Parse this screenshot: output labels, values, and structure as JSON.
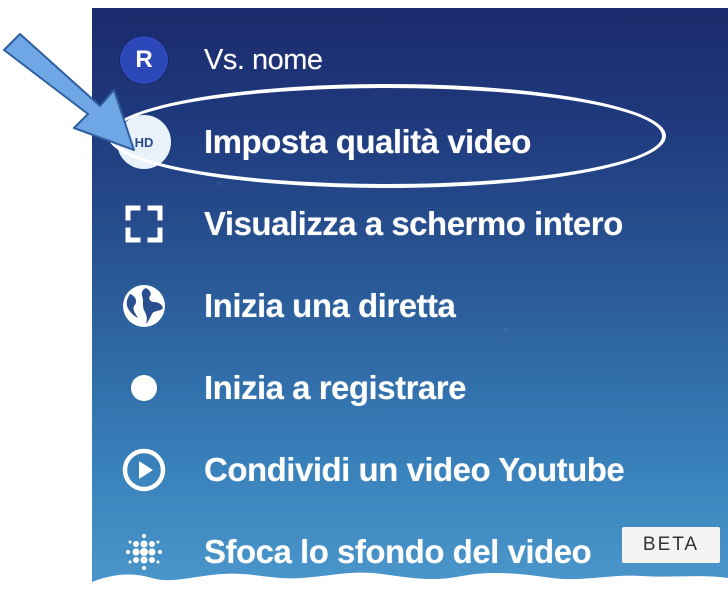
{
  "menu": {
    "items": [
      {
        "label": "Vs. nome",
        "icon": "avatar-icon",
        "avatar_letter": "R"
      },
      {
        "label": "Imposta qualità video",
        "icon": "hd-icon",
        "badge": "HD"
      },
      {
        "label": "Visualizza a schermo intero",
        "icon": "fullscreen-icon"
      },
      {
        "label": "Inizia una diretta",
        "icon": "globe-icon"
      },
      {
        "label": "Inizia a registrare",
        "icon": "record-icon"
      },
      {
        "label": "Condividi un video Youtube",
        "icon": "play-circle-icon"
      },
      {
        "label": "Sfoca lo sfondo del video",
        "icon": "blur-icon",
        "tag": "BETA"
      }
    ]
  },
  "colors": {
    "panel_top": "#1b2a6b",
    "panel_bottom": "#4c98cc",
    "avatar": "#2c47b8",
    "arrow": "#6fa6e6",
    "text": "#ffffff"
  }
}
